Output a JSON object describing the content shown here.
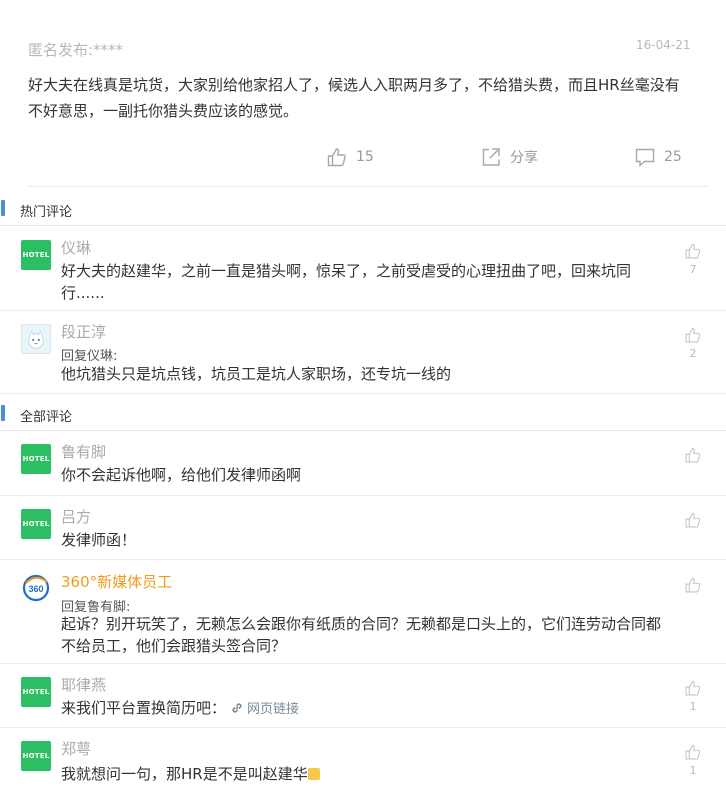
{
  "post": {
    "author": "匿名发布:****",
    "date": "16-04-21",
    "body": "好大夫在线真是坑货，大家别给他家招人了，候选人入职两月多了，不给猎头费，而且HR丝毫没有不好意思，一副托你猎头费应该的感觉。",
    "like_count": "15",
    "share_label": "分享",
    "comment_count": "25"
  },
  "sections": {
    "hot": "热门评论",
    "all": "全部评论"
  },
  "hot_comments": [
    {
      "name": "仪琳",
      "avatar": "HOTEL",
      "text": "好大夫的赵建华，之前一直是猎头啊，惊呆了，之前受虐受的心理扭曲了吧，回来坑同行......",
      "likes": "7"
    },
    {
      "name": "段正淳",
      "avatar": "cat",
      "reply": "回复仪琳:",
      "text": "他坑猎头只是坑点钱，坑员工是坑人家职场，还专坑一线的",
      "likes": "2"
    }
  ],
  "all_comments": [
    {
      "name": "鲁有脚",
      "avatar": "HOTEL",
      "text": "你不会起诉他啊，给他们发律师函啊"
    },
    {
      "name": "吕方",
      "avatar": "HOTEL",
      "text": "发律师函！"
    },
    {
      "name": "360°新媒体员工",
      "avatar": "360",
      "reply": "回复鲁有脚:",
      "text": "起诉？别开玩笑了，无赖怎么会跟你有纸质的合同？无赖都是口头上的，它们连劳动合同都不给员工，他们会跟猎头签合同？"
    },
    {
      "name": "耶律燕",
      "avatar": "HOTEL",
      "text": "来我们平台置换简历吧：",
      "link": "网页链接",
      "likes": "1"
    },
    {
      "name": "郑萼",
      "avatar": "HOTEL",
      "text": "我就想问一句，那HR是不是叫赵建华",
      "likes": "1"
    }
  ],
  "colors": {
    "accent_bar": "#4a8be0",
    "avatar_green": "#2bbe62",
    "highlight_name": "#f39a1e"
  }
}
